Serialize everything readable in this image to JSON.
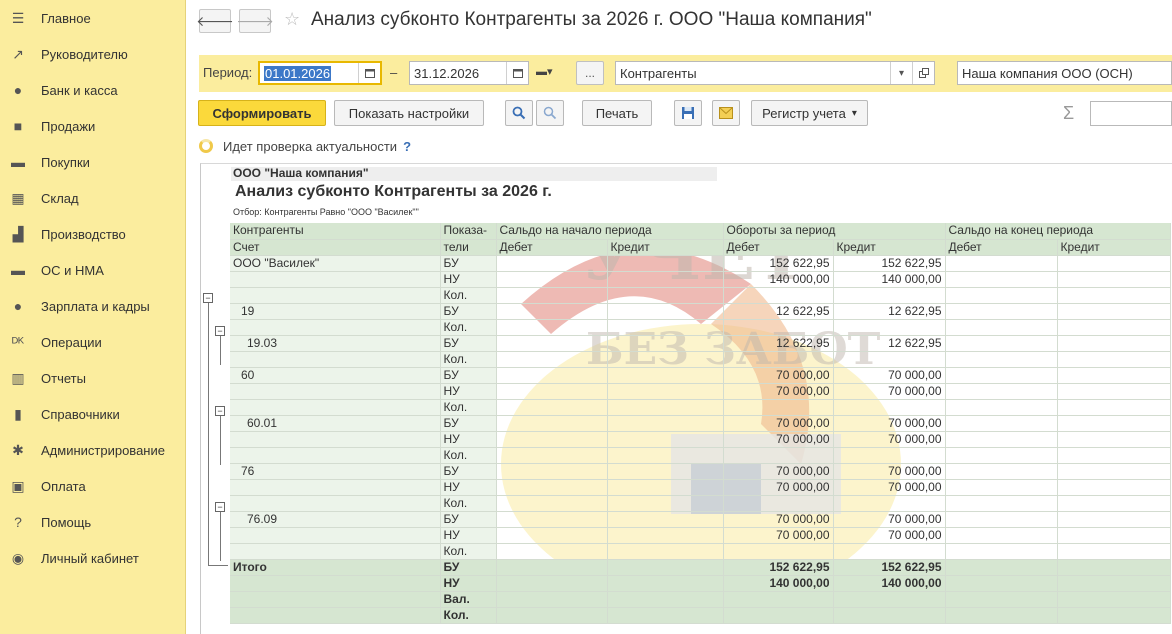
{
  "sidebar": {
    "items": [
      {
        "label": "Главное",
        "icon": "menu-icon"
      },
      {
        "label": "Руководителю",
        "icon": "trend-icon"
      },
      {
        "label": "Банк и касса",
        "icon": "coin-icon"
      },
      {
        "label": "Продажи",
        "icon": "bag-icon"
      },
      {
        "label": "Покупки",
        "icon": "cart-icon"
      },
      {
        "label": "Склад",
        "icon": "warehouse-icon"
      },
      {
        "label": "Производство",
        "icon": "factory-icon"
      },
      {
        "label": "ОС и НМА",
        "icon": "truck-icon"
      },
      {
        "label": "Зарплата и кадры",
        "icon": "person-icon"
      },
      {
        "label": "Операции",
        "icon": "dt-kt-icon"
      },
      {
        "label": "Отчеты",
        "icon": "bar-chart-icon"
      },
      {
        "label": "Справочники",
        "icon": "books-icon"
      },
      {
        "label": "Администрирование",
        "icon": "gear-icon"
      },
      {
        "label": "Оплата",
        "icon": "wallet-icon"
      },
      {
        "label": "Помощь",
        "icon": "question-icon"
      },
      {
        "label": "Личный кабинет",
        "icon": "user-circle-icon"
      }
    ]
  },
  "header": {
    "title": "Анализ субконто Контрагенты за 2026 г. ООО \"Наша компания\"",
    "back_glyph": "🡐",
    "forward_glyph": "🡒",
    "star_glyph": "☆"
  },
  "params": {
    "period_label": "Период:",
    "date_from_selected": "01.01.2026",
    "date_to": "31.12.2026",
    "dash": "–",
    "period_variant_glyph": "▬▾",
    "dots": "...",
    "subconto": "Контрагенты",
    "organization": "Наша компания ООО (ОСН)"
  },
  "toolbar": {
    "generate_label": "Сформировать",
    "settings_label": "Показать настройки",
    "print_label": "Печать",
    "register_label": "Регистр учета",
    "register_arrow": "▾",
    "sigma": "Σ"
  },
  "status": {
    "text": "Идет проверка актуальности",
    "help": "?"
  },
  "report": {
    "org": "ООО \"Наша компания\"",
    "title": "Анализ субконто Контрагенты за 2026 г.",
    "filter": "Отбор: Контрагенты Равно \"ООО \"Василек\"\"",
    "headers": {
      "h1_col0": "Контрагенты",
      "h1_col1": "Показа-",
      "h1_saldo_start": "Сальдо на начало периода",
      "h1_turnover": "Обороты за период",
      "h1_saldo_end": "Сальдо на конец периода",
      "h2_col0": "Счет",
      "h2_col1": "тели",
      "debit": "Дебет",
      "credit": "Кредит"
    },
    "rows": [
      {
        "name": "ООО \"Василек\"",
        "ind": "БУ",
        "tdt": "152 622,95",
        "tct": "152 622,95"
      },
      {
        "name": "",
        "ind": "НУ",
        "tdt": "140 000,00",
        "tct": "140 000,00"
      },
      {
        "name": "",
        "ind": "Кол.",
        "tdt": "",
        "tct": ""
      },
      {
        "name": "19",
        "ind": "БУ",
        "tdt": "12 622,95",
        "tct": "12 622,95"
      },
      {
        "name": "",
        "ind": "Кол.",
        "tdt": "",
        "tct": ""
      },
      {
        "name": "19.03",
        "ind": "БУ",
        "tdt": "12 622,95",
        "tct": "12 622,95"
      },
      {
        "name": "",
        "ind": "Кол.",
        "tdt": "",
        "tct": ""
      },
      {
        "name": "60",
        "ind": "БУ",
        "tdt": "70 000,00",
        "tct": "70 000,00"
      },
      {
        "name": "",
        "ind": "НУ",
        "tdt": "70 000,00",
        "tct": "70 000,00"
      },
      {
        "name": "",
        "ind": "Кол.",
        "tdt": "",
        "tct": ""
      },
      {
        "name": "60.01",
        "ind": "БУ",
        "tdt": "70 000,00",
        "tct": "70 000,00"
      },
      {
        "name": "",
        "ind": "НУ",
        "tdt": "70 000,00",
        "tct": "70 000,00"
      },
      {
        "name": "",
        "ind": "Кол.",
        "tdt": "",
        "tct": ""
      },
      {
        "name": "76",
        "ind": "БУ",
        "tdt": "70 000,00",
        "tct": "70 000,00"
      },
      {
        "name": "",
        "ind": "НУ",
        "tdt": "70 000,00",
        "tct": "70 000,00"
      },
      {
        "name": "",
        "ind": "Кол.",
        "tdt": "",
        "tct": ""
      },
      {
        "name": "76.09",
        "ind": "БУ",
        "tdt": "70 000,00",
        "tct": "70 000,00"
      },
      {
        "name": "",
        "ind": "НУ",
        "tdt": "70 000,00",
        "tct": "70 000,00"
      },
      {
        "name": "",
        "ind": "Кол.",
        "tdt": "",
        "tct": ""
      }
    ],
    "totals": [
      {
        "name": "Итого",
        "ind": "БУ",
        "tdt": "152 622,95",
        "tct": "152 622,95"
      },
      {
        "name": "",
        "ind": "НУ",
        "tdt": "140 000,00",
        "tct": "140 000,00"
      },
      {
        "name": "",
        "ind": "Вал.",
        "tdt": "",
        "tct": ""
      },
      {
        "name": "",
        "ind": "Кол.",
        "tdt": "",
        "tct": ""
      }
    ],
    "collapse_glyph": "−",
    "watermark_line1": "УЧЕТ",
    "watermark_line2": "БЕЗ ЗАБОТ"
  },
  "colors": {
    "sidebar_bg": "#fbed9e",
    "primary_button": "#fbd93b",
    "header_green": "#d6e6d1",
    "cell_green": "#ecf4ea"
  }
}
